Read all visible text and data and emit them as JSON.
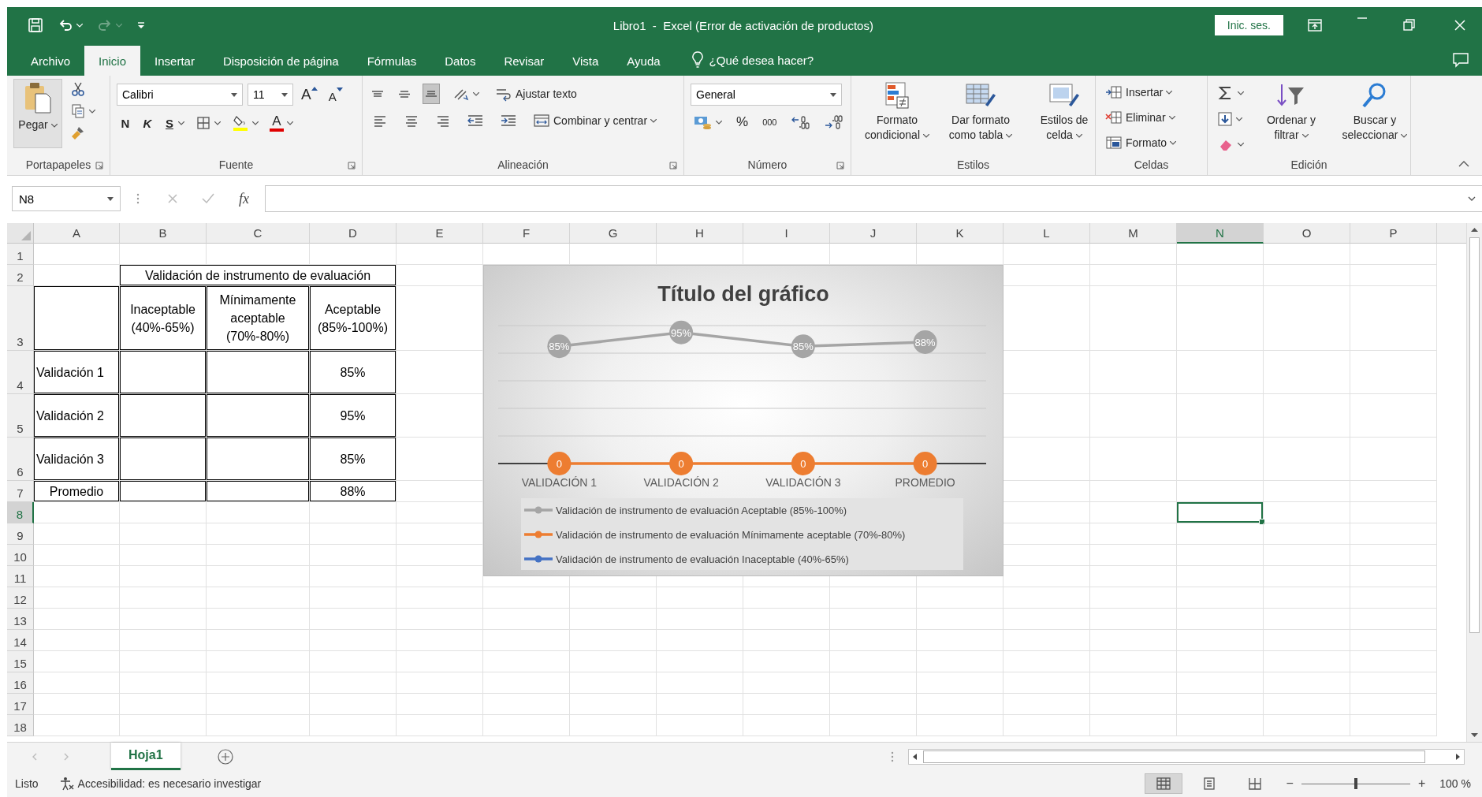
{
  "title_bar": {
    "quick_access": [
      {
        "kind": "save",
        "disabled": false
      },
      {
        "kind": "undo",
        "dropdown": true,
        "disabled": false
      },
      {
        "kind": "redo",
        "dropdown": true,
        "disabled": true
      },
      {
        "kind": "customize",
        "disabled": false
      }
    ],
    "title": "Libro1  -  Excel (Error de activación de productos)",
    "sign_in": "Inic. ses.",
    "window_controls": [
      {
        "kind": "ribbon-display"
      },
      {
        "kind": "minimize"
      },
      {
        "kind": "restore"
      },
      {
        "kind": "close"
      }
    ]
  },
  "ribbon_tabs": [
    {
      "label": "Archivo",
      "selected": false
    },
    {
      "label": "Inicio",
      "selected": true
    },
    {
      "label": "Insertar",
      "selected": false
    },
    {
      "label": "Disposición de página",
      "selected": false
    },
    {
      "label": "Fórmulas",
      "selected": false
    },
    {
      "label": "Datos",
      "selected": false
    },
    {
      "label": "Revisar",
      "selected": false
    },
    {
      "label": "Vista",
      "selected": false
    },
    {
      "label": "Ayuda",
      "selected": false
    }
  ],
  "tell_me": {
    "placeholder": "¿Qué desea hacer?"
  },
  "ribbon": {
    "groups": [
      {
        "label": "Portapapeles",
        "launcher": true,
        "kind": "columns",
        "sections": [
          [
            {
              "kind": "paste",
              "label": "Pegar",
              "large": true,
              "dropdown": true
            }
          ],
          [
            {
              "kind": "cut"
            },
            {
              "kind": "copy",
              "dropdown": true
            },
            {
              "kind": "format-painter"
            }
          ]
        ]
      },
      {
        "label": "Fuente",
        "launcher": true,
        "kind": "rows",
        "sections": [
          [
            {
              "kind": "font-combo",
              "value": "Calibri"
            },
            {
              "kind": "size-combo",
              "value": "11"
            },
            {
              "kind": "grow-font",
              "label": "A"
            },
            {
              "kind": "shrink-font",
              "label": "A"
            }
          ],
          [
            {
              "kind": "bold",
              "label": "N",
              "selected": false
            },
            {
              "kind": "italic",
              "label": "K",
              "selected": false
            },
            {
              "kind": "underline",
              "label": "S",
              "selected": false,
              "dropdown": true
            },
            {
              "kind": "borders",
              "dropdown": true
            },
            {
              "kind": "fill-color",
              "dropdown": true
            },
            {
              "kind": "font-color",
              "label": "A",
              "dropdown": true
            }
          ]
        ]
      },
      {
        "label": "Alineación",
        "launcher": true,
        "kind": "rows",
        "sections": [
          [
            {
              "kind": "align-top",
              "selected": false
            },
            {
              "kind": "align-middle",
              "selected": false
            },
            {
              "kind": "align-bottom",
              "selected": true
            },
            {
              "kind": "orientation",
              "dropdown": true
            },
            {
              "kind": "wrap-text",
              "label": "Ajustar texto",
              "selected": false
            }
          ],
          [
            {
              "kind": "align-left",
              "selected": false
            },
            {
              "kind": "align-center",
              "selected": false
            },
            {
              "kind": "align-right",
              "selected": false
            },
            {
              "kind": "outdent"
            },
            {
              "kind": "indent"
            },
            {
              "kind": "merge",
              "label": "Combinar y centrar",
              "dropdown": true,
              "selected": false
            }
          ]
        ]
      },
      {
        "label": "Número",
        "launcher": true,
        "kind": "rows",
        "sections": [
          [
            {
              "kind": "format-combo",
              "value": "General"
            }
          ],
          [
            {
              "kind": "accounting",
              "dropdown": true
            },
            {
              "kind": "percent",
              "label": "%"
            },
            {
              "kind": "thousands",
              "label": "000"
            },
            {
              "kind": "inc-decimal"
            },
            {
              "kind": "dec-decimal"
            }
          ]
        ]
      },
      {
        "label": "Estilos",
        "launcher": false,
        "kind": "columns",
        "sections": [
          [
            {
              "kind": "cond-format",
              "label": "Formato condicional",
              "large": true,
              "dropdown": true
            }
          ],
          [
            {
              "kind": "format-table",
              "label": "Dar formato como tabla",
              "large": true,
              "dropdown": true
            }
          ],
          [
            {
              "kind": "cell-styles",
              "label": "Estilos de celda",
              "large": true,
              "dropdown": true
            }
          ]
        ]
      },
      {
        "label": "Celdas",
        "launcher": false,
        "kind": "columns",
        "sections": [
          [
            {
              "kind": "insert-cells",
              "label": "Insertar",
              "dropdown": true
            },
            {
              "kind": "delete-cells",
              "label": "Eliminar",
              "dropdown": true
            },
            {
              "kind": "format-cells",
              "label": "Formato",
              "dropdown": true
            }
          ]
        ]
      },
      {
        "label": "Edición",
        "launcher": false,
        "kind": "columns",
        "sections": [
          [
            {
              "kind": "autosum",
              "dropdown": true
            },
            {
              "kind": "fill-down",
              "dropdown": true
            },
            {
              "kind": "clear",
              "dropdown": true
            }
          ],
          [
            {
              "kind": "sort-filter",
              "label": "Ordenar y filtrar",
              "large": true,
              "dropdown": true
            }
          ],
          [
            {
              "kind": "find",
              "label": "Buscar y seleccionar",
              "large": true,
              "dropdown": true
            }
          ]
        ]
      }
    ]
  },
  "formula_bar": {
    "name_box": "N8",
    "function_button": "fx"
  },
  "sheet": {
    "columns": [
      {
        "label": "A",
        "selected": false
      },
      {
        "label": "B",
        "selected": false
      },
      {
        "label": "C",
        "selected": false
      },
      {
        "label": "D",
        "selected": false
      },
      {
        "label": "E",
        "selected": false
      },
      {
        "label": "F",
        "selected": false
      },
      {
        "label": "G",
        "selected": false
      },
      {
        "label": "H",
        "selected": false
      },
      {
        "label": "I",
        "selected": false
      },
      {
        "label": "J",
        "selected": false
      },
      {
        "label": "K",
        "selected": false
      },
      {
        "label": "L",
        "selected": false
      },
      {
        "label": "M",
        "selected": false
      },
      {
        "label": "N",
        "selected": true
      },
      {
        "label": "O",
        "selected": false
      },
      {
        "label": "P",
        "selected": false
      }
    ],
    "rows": [
      {
        "label": "1",
        "selected": false
      },
      {
        "label": "2",
        "selected": false,
        "cells": {
          "B": {
            "text": "Validación de instrumento de evaluación",
            "borders": true,
            "centered": true
          },
          "C": {
            "merged": true
          },
          "D": {
            "merged": true
          }
        }
      },
      {
        "label": "3",
        "selected": false,
        "cells": {
          "A": {
            "borders": true
          },
          "B": {
            "text": "Inaceptable (40%-65%)",
            "borders": true,
            "centered": true
          },
          "C": {
            "text": "Mínimamente aceptable (70%-80%)",
            "borders": true,
            "centered": true
          },
          "D": {
            "text": "Aceptable (85%-100%)",
            "borders": true,
            "centered": true
          }
        }
      },
      {
        "label": "4",
        "selected": false,
        "cells": {
          "A": {
            "text": "Validación 1",
            "borders": true,
            "centered": false
          },
          "B": {
            "borders": true
          },
          "C": {
            "borders": true
          },
          "D": {
            "text": "85%",
            "borders": true,
            "centered": true
          }
        }
      },
      {
        "label": "5",
        "selected": false,
        "cells": {
          "A": {
            "text": "Validación 2",
            "borders": true,
            "centered": false
          },
          "B": {
            "borders": true
          },
          "C": {
            "borders": true
          },
          "D": {
            "text": "95%",
            "borders": true,
            "centered": true
          }
        }
      },
      {
        "label": "6",
        "selected": false,
        "cells": {
          "A": {
            "text": "Validación 3",
            "borders": true,
            "centered": false
          },
          "B": {
            "borders": true
          },
          "C": {
            "borders": true
          },
          "D": {
            "text": "85%",
            "borders": true,
            "centered": true
          }
        }
      },
      {
        "label": "7",
        "selected": false,
        "cells": {
          "A": {
            "text": "Promedio",
            "borders": true,
            "centered": true
          },
          "B": {
            "borders": true
          },
          "C": {
            "borders": true
          },
          "D": {
            "text": "88%",
            "borders": true,
            "centered": true
          }
        }
      },
      {
        "label": "8",
        "selected": true
      },
      {
        "label": "9",
        "selected": false
      },
      {
        "label": "10",
        "selected": false
      },
      {
        "label": "11",
        "selected": false
      },
      {
        "label": "12",
        "selected": false
      },
      {
        "label": "13",
        "selected": false
      },
      {
        "label": "14",
        "selected": false
      },
      {
        "label": "15",
        "selected": false
      },
      {
        "label": "16",
        "selected": false
      },
      {
        "label": "17",
        "selected": false
      },
      {
        "label": "18",
        "selected": false
      }
    ],
    "chart": {
      "chart_data": {
        "type": "line",
        "title": "Título del gráfico",
        "categories": [
          "VALIDACIÓN 1",
          "VALIDACIÓN 2",
          "VALIDACIÓN 3",
          "PROMEDIO"
        ],
        "ylim": [
          0,
          1
        ],
        "data_labels": true,
        "series": [
          {
            "name": "Validación de instrumento de evaluación Aceptable (85%-100%)",
            "color": "#a5a5a5",
            "marker": "circle",
            "values": [
              0.85,
              0.95,
              0.85,
              0.88
            ],
            "value_labels": [
              "85%",
              "95%",
              "85%",
              "88%"
            ]
          },
          {
            "name": "Validación de instrumento de evaluación Mínimamente aceptable (70%-80%)",
            "color": "#ed7d31",
            "marker": "circle",
            "values": [
              0,
              0,
              0,
              0
            ],
            "value_labels": [
              "0",
              "0",
              "0",
              "0"
            ]
          },
          {
            "name": "Validación de instrumento de evaluación Inaceptable (40%-65%)",
            "color": "#4472c4",
            "marker": "circle",
            "values": [
              null,
              null,
              null,
              null
            ]
          }
        ],
        "legend": true
      }
    }
  },
  "sheet_tabs": [
    {
      "label": "Hoja1",
      "selected": true
    }
  ],
  "status_bar": {
    "mode": "Listo",
    "accessibility": "Accesibilidad: es necesario investigar",
    "views": [
      {
        "kind": "normal",
        "selected": true
      },
      {
        "kind": "page-layout",
        "selected": false
      },
      {
        "kind": "page-break",
        "selected": false
      }
    ],
    "zoom": {
      "minus": "−",
      "plus": "+",
      "level": 0.5,
      "reading": "100 %"
    }
  }
}
